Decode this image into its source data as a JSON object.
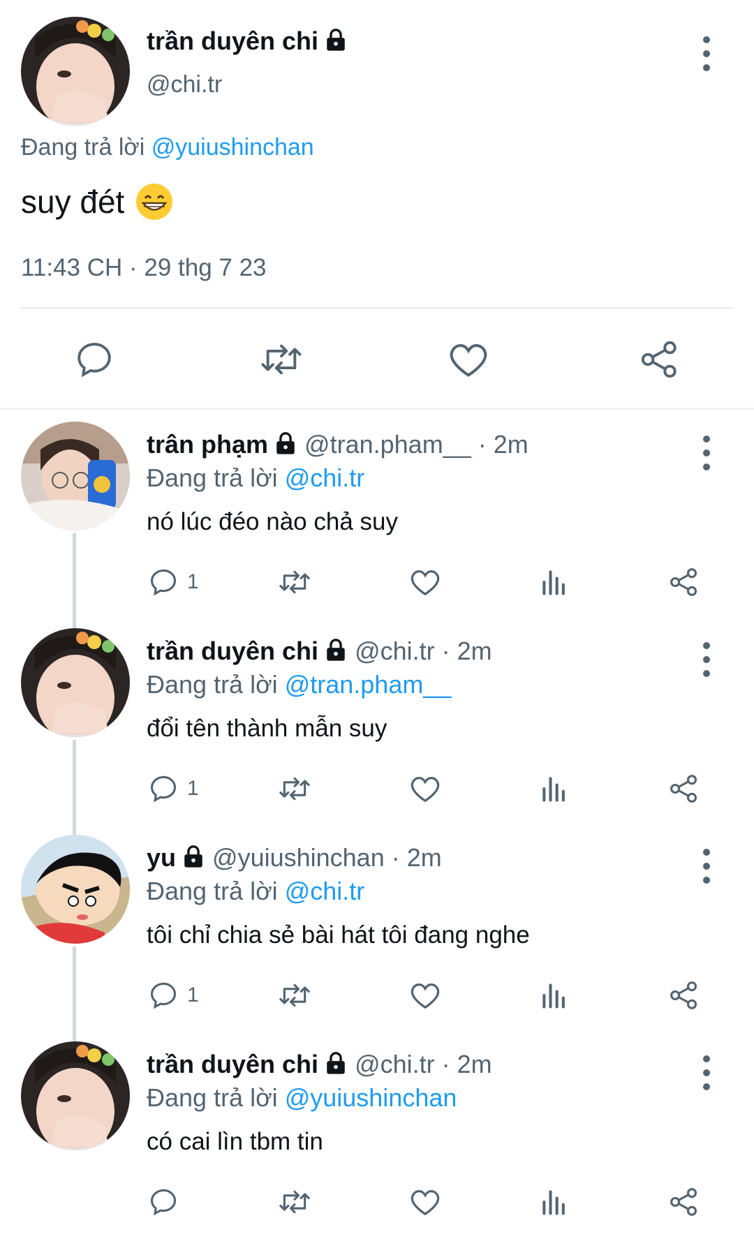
{
  "main_tweet": {
    "display_name": "trần duyên chi",
    "handle": "@chi.tr",
    "replying_label": "Đang trả lời",
    "replying_to": "@yuiushinchan",
    "text": "suy đét",
    "emoji": "😁",
    "timestamp": "11:43 CH · 29 thg 7 23"
  },
  "replies": [
    {
      "display_name": "trân phạm",
      "handle": "@tran.pham__",
      "time": "· 2m",
      "replying_label": "Đang trả lời",
      "replying_to": "@chi.tr",
      "text": "nó lúc đéo nào chả suy",
      "reply_count": "1",
      "avatar": "tran-pham-avatar"
    },
    {
      "display_name": "trần duyên chi",
      "handle": "@chi.tr",
      "time": "· 2m",
      "replying_label": "Đang trả lời",
      "replying_to": "@tran.pham__",
      "text": "đổi tên thành mẫn suy",
      "reply_count": "1",
      "avatar": "chi-tr-avatar"
    },
    {
      "display_name": "yu",
      "handle": "@yuiushinchan",
      "time": "· 2m",
      "replying_label": "Đang trả lời",
      "replying_to": "@chi.tr",
      "text": "tôi chỉ chia sẻ bài hát tôi đang nghe",
      "reply_count": "1",
      "avatar": "shinchan-avatar"
    },
    {
      "display_name": "trần duyên chi",
      "handle": "@chi.tr",
      "time": "· 2m",
      "replying_label": "Đang trả lời",
      "replying_to": "@yuiushinchan",
      "text": "có cai lìn tbm tin",
      "reply_count": "",
      "avatar": "chi-tr-avatar"
    }
  ],
  "icons": {
    "reply": "comment-icon",
    "retweet": "retweet-icon",
    "like": "heart-icon",
    "views": "analytics-icon",
    "share": "share-icon",
    "lock": "lock-icon",
    "more": "more-vertical-icon"
  },
  "colors": {
    "link": "#1d9bf0",
    "secondary_text": "#536471",
    "primary_text": "#0f1419"
  }
}
